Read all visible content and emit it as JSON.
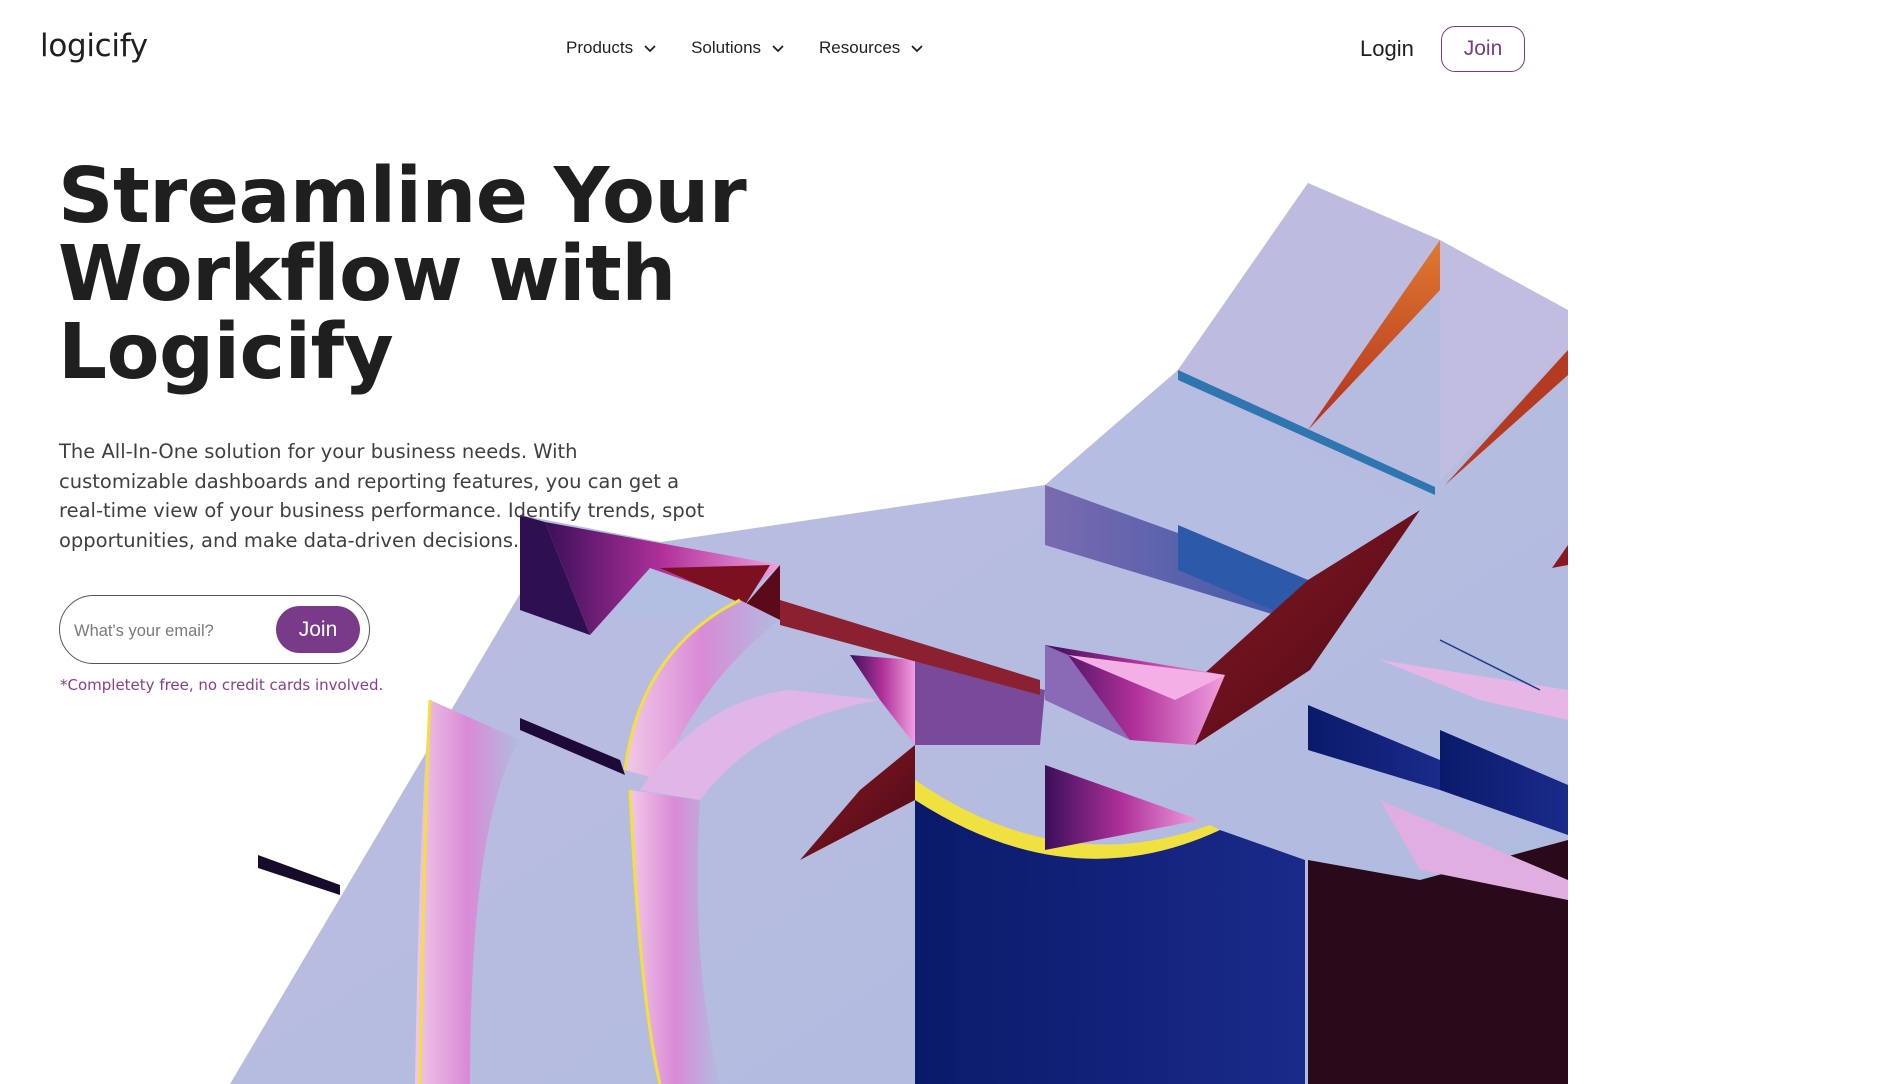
{
  "header": {
    "logo": "logicify",
    "nav": [
      {
        "label": "Products"
      },
      {
        "label": "Solutions"
      },
      {
        "label": "Resources"
      }
    ],
    "login_label": "Login",
    "join_label": "Join"
  },
  "hero": {
    "title_line1": "Streamline Your",
    "title_line2": "Workflow with",
    "title_line3": "Logicify",
    "description": "The All-In-One solution for your business needs. With customizable dashboards and reporting features, you can get a real-time view of your business performance. Identify trends, spot opportunities, and make data-driven decisions.",
    "email_placeholder": "What's your email?",
    "join_label": "Join",
    "footnote": "*Completety free, no credit cards involved."
  },
  "colors": {
    "brand": "#7a3a8a",
    "text": "#1f1f1f"
  },
  "icons": {
    "nav_chevron": "chevron-down-icon"
  }
}
